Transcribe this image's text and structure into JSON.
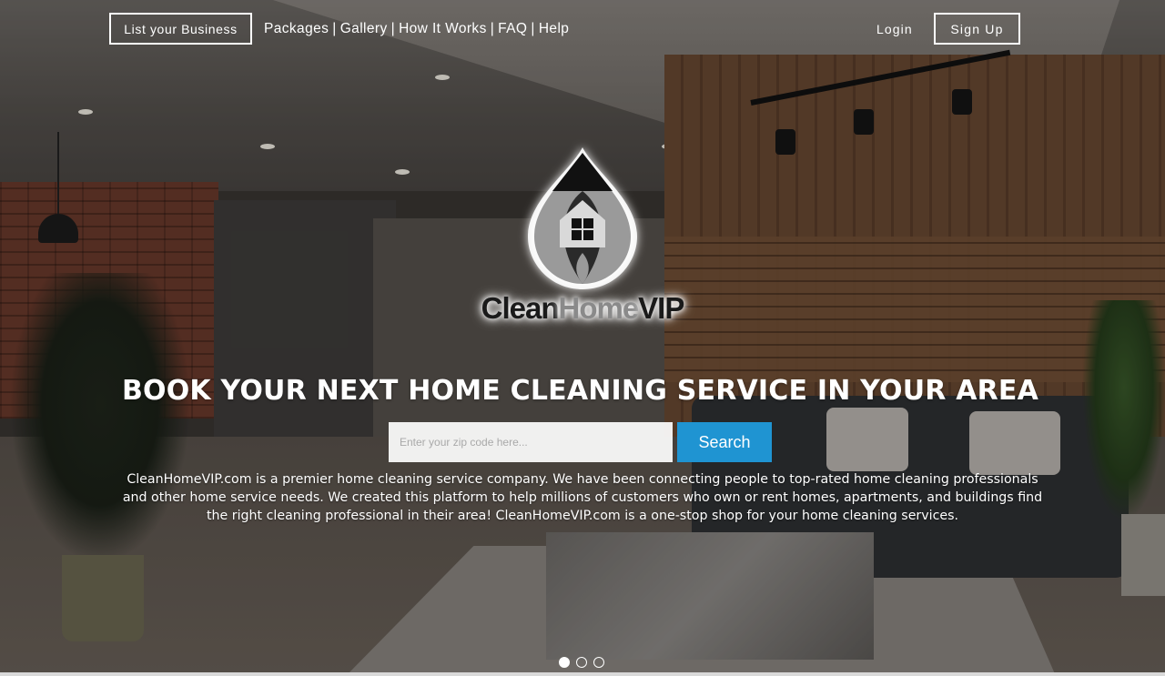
{
  "header": {
    "list_business_label": "List your Business",
    "nav": [
      {
        "label": "Packages"
      },
      {
        "label": "Gallery"
      },
      {
        "label": "How It Works"
      },
      {
        "label": "FAQ"
      },
      {
        "label": "Help"
      }
    ],
    "nav_separator": "|",
    "login_label": "Login",
    "signup_label": "Sign Up"
  },
  "logo": {
    "word_clean": "Clean",
    "word_home": "Home",
    "word_vip": "VIP"
  },
  "hero": {
    "headline": "BOOK YOUR NEXT HOME CLEANING SERVICE IN YOUR AREA",
    "search_placeholder": "Enter your zip code here...",
    "search_value": "",
    "search_button_label": "Search",
    "description": "CleanHomeVIP.com is a premier home cleaning service company. We have been connecting people to top-rated home cleaning professionals and other home service needs. We created this platform to help millions of customers who own or rent homes, apartments, and buildings find the right cleaning professional in their area! CleanHomeVIP.com is a one-stop shop for your home cleaning services."
  },
  "carousel": {
    "active_index": 0,
    "slide_count": 3
  },
  "colors": {
    "search_button": "#1f94d2",
    "text": "#ffffff"
  }
}
